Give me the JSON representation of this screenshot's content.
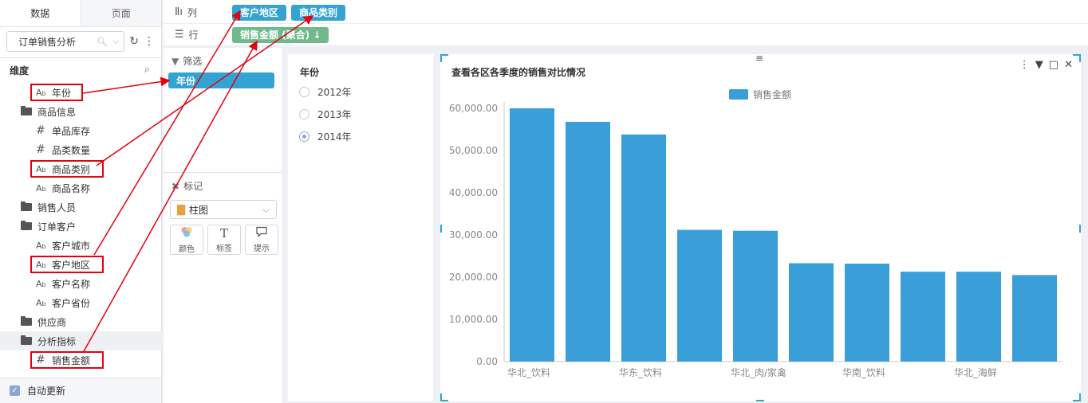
{
  "left_panel": {
    "tabs": [
      "数据",
      "页面"
    ],
    "dataset": "订单销售分析",
    "dim_header": "维度",
    "tree": [
      {
        "label": "年份",
        "type": "text",
        "level": 1,
        "boxed": true
      },
      {
        "label": "商品信息",
        "type": "folder",
        "level": 0
      },
      {
        "label": "单品库存",
        "type": "number",
        "level": 1
      },
      {
        "label": "品类数量",
        "type": "number",
        "level": 1
      },
      {
        "label": "商品类别",
        "type": "text",
        "level": 1,
        "boxed": true
      },
      {
        "label": "商品名称",
        "type": "text",
        "level": 1
      },
      {
        "label": "销售人员",
        "type": "folder",
        "level": 0
      },
      {
        "label": "订单客户",
        "type": "folder",
        "level": 0
      },
      {
        "label": "客户城市",
        "type": "text",
        "level": 1
      },
      {
        "label": "客户地区",
        "type": "text",
        "level": 1,
        "boxed": true
      },
      {
        "label": "客户名称",
        "type": "text",
        "level": 1
      },
      {
        "label": "客户省份",
        "type": "text",
        "level": 1
      },
      {
        "label": "供应商",
        "type": "folder",
        "level": 0
      },
      {
        "label": "分析指标",
        "type": "folder",
        "level": 0,
        "highlight": true
      },
      {
        "label": "销售金额",
        "type": "number",
        "level": 1,
        "boxed": true
      }
    ],
    "auto_update": "自动更新"
  },
  "shelves": {
    "columns_label": "列",
    "rows_label": "行",
    "column_pills": [
      "客户地区",
      "商品类别"
    ],
    "row_pills": [
      "销售金额 (聚合) ↓"
    ]
  },
  "filter_panel": {
    "filter_label": "筛选",
    "filter_pill": "年份",
    "marks_label": "标记",
    "mark_type": "柱图",
    "mark_buttons": [
      {
        "icon": "color-icon",
        "label": "颜色"
      },
      {
        "icon": "text-icon",
        "glyph": "T",
        "label": "标签"
      },
      {
        "icon": "tooltip-icon",
        "glyph": "💬",
        "label": "提示"
      }
    ]
  },
  "year_filter": {
    "title": "年份",
    "options": [
      "2012年",
      "2013年",
      "2014年"
    ],
    "selected": "2014年"
  },
  "chart_data": {
    "type": "bar",
    "title": "查看各区各季度的销售对比情况",
    "legend": "销售金额",
    "series_color": "#3a9fd8",
    "ylim": [
      0,
      60000
    ],
    "yticks": [
      "0.00",
      "10,000.00",
      "20,000.00",
      "30,000.00",
      "40,000.00",
      "50,000.00",
      "60,000.00"
    ],
    "xtick_labels": [
      "华北_饮料",
      "",
      "华东_饮料",
      "",
      "华北_肉/家禽",
      "",
      "华南_饮料",
      "",
      "华北_海鲜",
      ""
    ],
    "values": [
      60000,
      56800,
      53800,
      31200,
      31000,
      23300,
      23200,
      21300,
      21300,
      20500
    ]
  }
}
